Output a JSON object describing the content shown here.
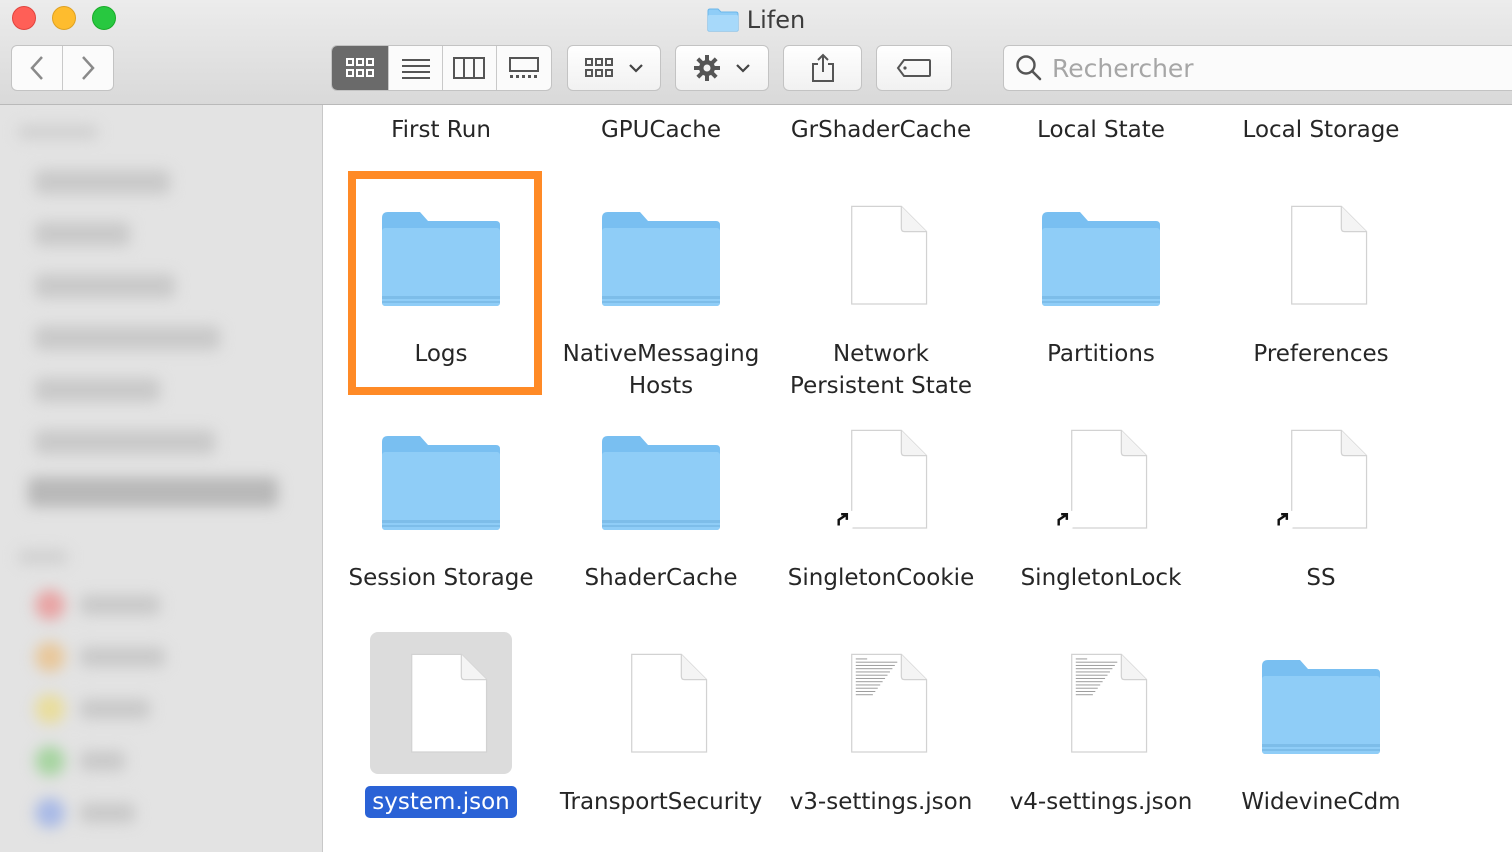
{
  "window": {
    "title": "Lifen"
  },
  "toolbar": {
    "back_icon": "chevron-left-icon",
    "forward_icon": "chevron-right-icon",
    "view_modes": [
      "icon-view",
      "list-view",
      "column-view",
      "gallery-view"
    ],
    "active_view": "icon-view",
    "search_placeholder": "Rechercher"
  },
  "files": [
    {
      "name": "First Run",
      "kind": "label-only"
    },
    {
      "name": "GPUCache",
      "kind": "label-only"
    },
    {
      "name": "GrShaderCache",
      "kind": "label-only"
    },
    {
      "name": "Local State",
      "kind": "label-only"
    },
    {
      "name": "Local Storage",
      "kind": "label-only"
    },
    {
      "name": "Logs",
      "kind": "folder",
      "highlighted": true
    },
    {
      "name": "NativeMessaging",
      "name2": "Hosts",
      "kind": "folder"
    },
    {
      "name": "Network",
      "name2": "Persistent State",
      "kind": "document"
    },
    {
      "name": "Partitions",
      "kind": "folder"
    },
    {
      "name": "Preferences",
      "kind": "document"
    },
    {
      "name": "Session Storage",
      "kind": "folder"
    },
    {
      "name": "ShaderCache",
      "kind": "folder"
    },
    {
      "name": "SingletonCookie",
      "kind": "alias"
    },
    {
      "name": "SingletonLock",
      "kind": "alias"
    },
    {
      "name": "SS",
      "kind": "alias"
    },
    {
      "name": "system.json",
      "kind": "document",
      "selected": true
    },
    {
      "name": "TransportSecurity",
      "kind": "document"
    },
    {
      "name": "v3-settings.json",
      "kind": "document-text"
    },
    {
      "name": "v4-settings.json",
      "kind": "document-text"
    },
    {
      "name": "WidevineCdm",
      "kind": "folder"
    }
  ],
  "colors": {
    "folder": "#8fcdf7",
    "selection": "#2a62d6",
    "highlight": "#ff8a26"
  }
}
